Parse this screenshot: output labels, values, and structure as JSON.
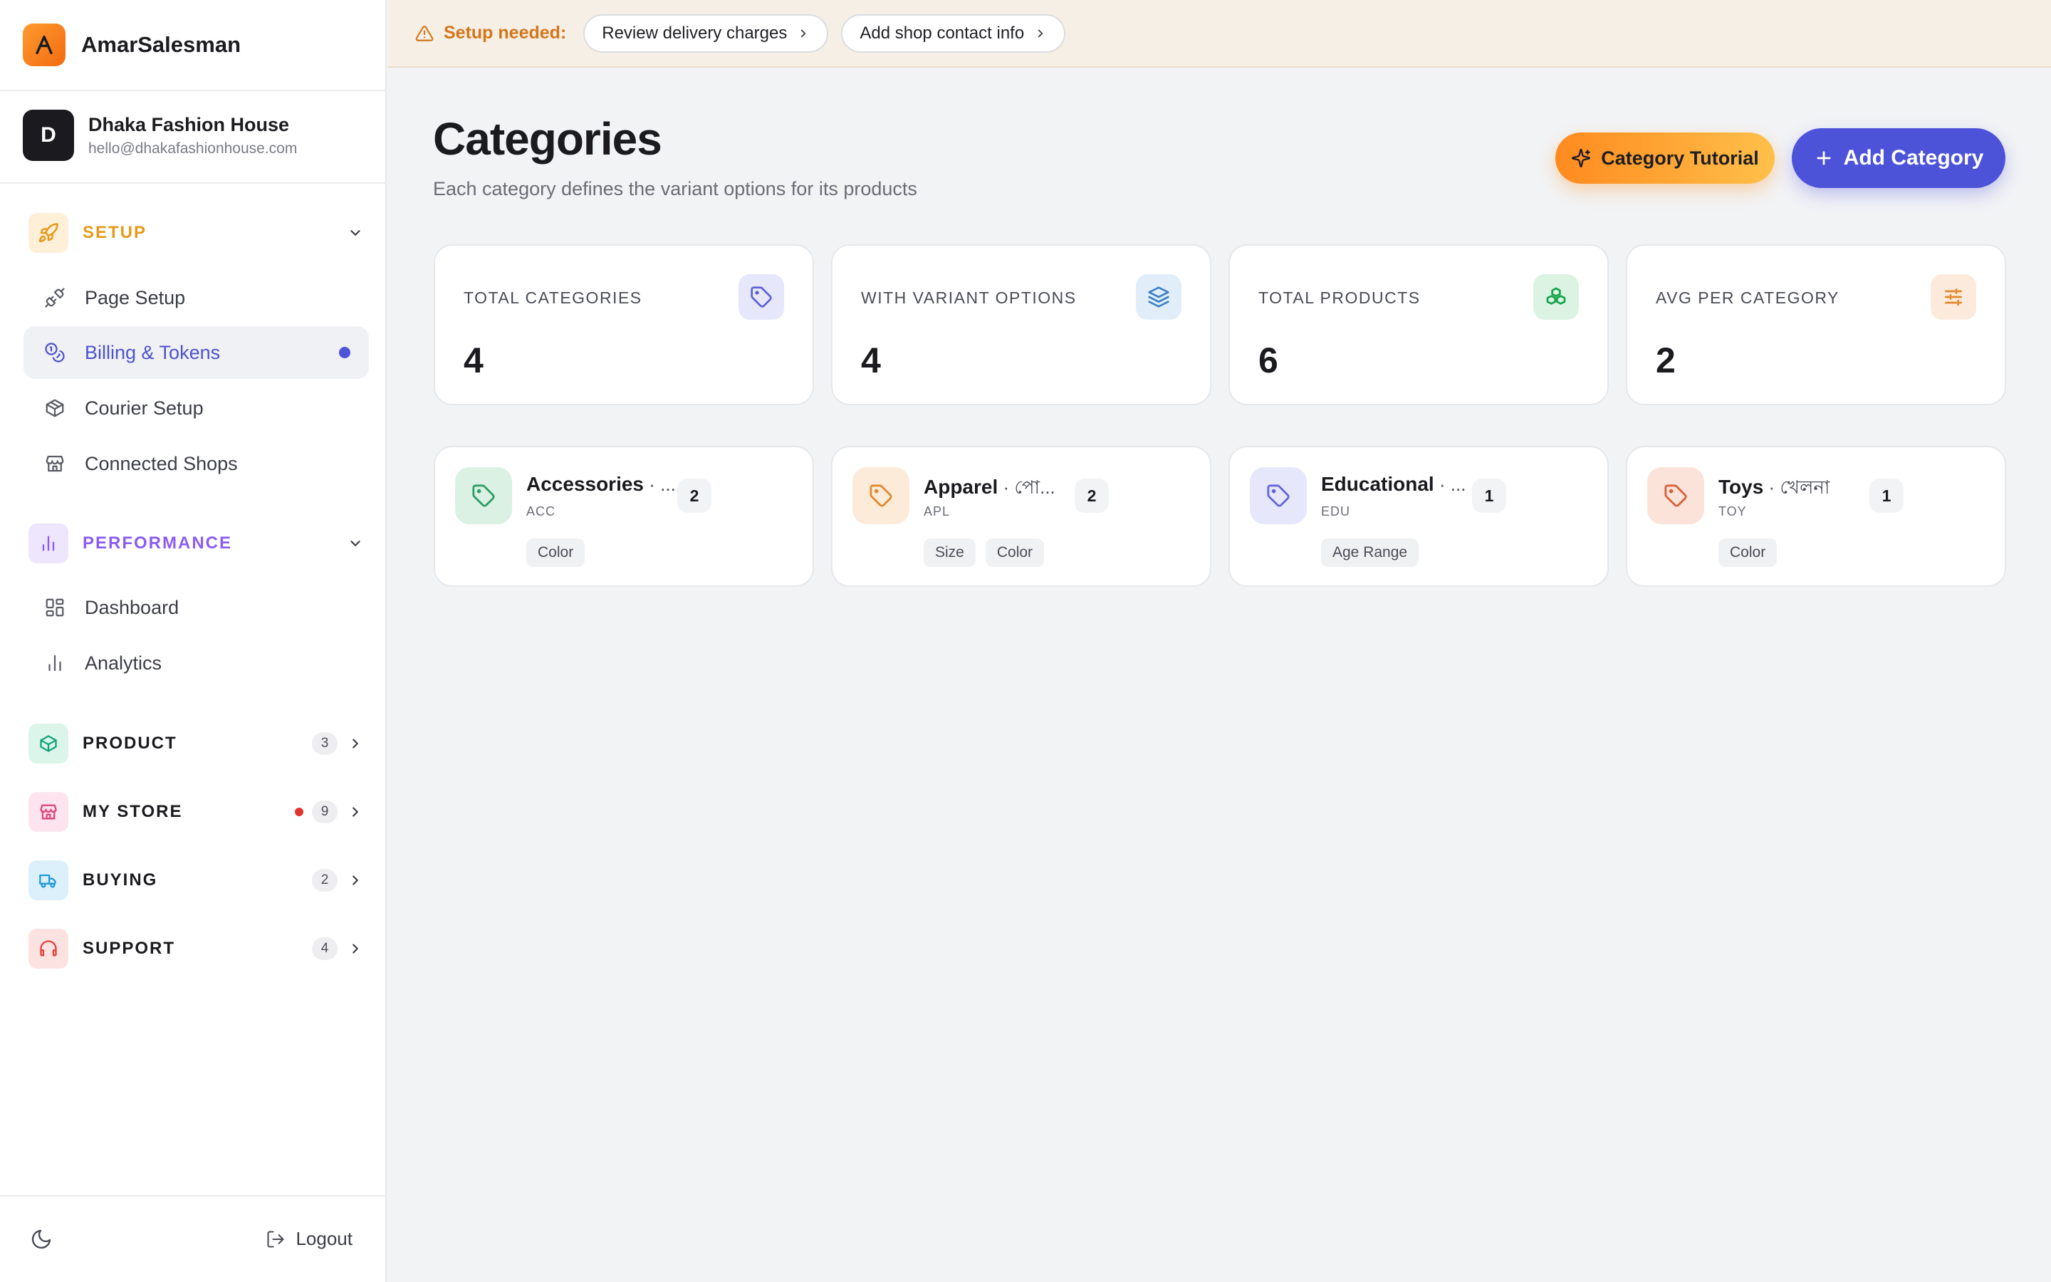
{
  "app": {
    "name": "AmarSalesman",
    "logo_letter": "A"
  },
  "shop": {
    "avatar_letter": "D",
    "name": "Dhaka Fashion House",
    "email": "hello@dhakafashionhouse.com"
  },
  "sidebar": {
    "setup": {
      "label": "SETUP",
      "color": "#e59a1b",
      "items": [
        {
          "label": "Page Setup",
          "icon": "plug-icon"
        },
        {
          "label": "Billing & Tokens",
          "icon": "coins-icon",
          "active": true
        },
        {
          "label": "Courier Setup",
          "icon": "package-icon"
        },
        {
          "label": "Connected Shops",
          "icon": "store-icon"
        }
      ]
    },
    "performance": {
      "label": "PERFORMANCE",
      "color": "#8b5cf6",
      "items": [
        {
          "label": "Dashboard",
          "icon": "dashboard-icon"
        },
        {
          "label": "Analytics",
          "icon": "bar-chart-icon"
        }
      ]
    },
    "product": {
      "label": "PRODUCT",
      "count": "3"
    },
    "my_store": {
      "label": "MY STORE",
      "count": "9",
      "alert": true
    },
    "buying": {
      "label": "BUYING",
      "count": "2"
    },
    "support": {
      "label": "SUPPORT",
      "count": "4"
    },
    "logout_label": "Logout"
  },
  "banner": {
    "label": "Setup needed:",
    "actions": [
      "Review delivery charges",
      "Add shop contact info"
    ]
  },
  "header": {
    "title": "Categories",
    "subtitle": "Each category defines the variant options for its products",
    "tutorial_button": "Category Tutorial",
    "add_button": "Add Category"
  },
  "stats": [
    {
      "label": "TOTAL CATEGORIES",
      "value": "4",
      "icon": "tag-icon",
      "color": "#5b5fd6"
    },
    {
      "label": "WITH VARIANT OPTIONS",
      "value": "4",
      "icon": "layers-icon",
      "color": "#3b82c4"
    },
    {
      "label": "TOTAL PRODUCTS",
      "value": "6",
      "icon": "boxes-icon",
      "color": "#16a34a"
    },
    {
      "label": "AVG PER CATEGORY",
      "value": "2",
      "icon": "sliders-icon",
      "color": "#e0862b"
    }
  ],
  "categories": [
    {
      "name": "Accessories",
      "sub": " · ...",
      "code": "ACC",
      "count": "2",
      "tags": [
        "Color"
      ],
      "color": "#2f9e63"
    },
    {
      "name": "Apparel",
      "sub": " · পো...",
      "code": "APL",
      "count": "2",
      "tags": [
        "Size",
        "Color"
      ],
      "color": "#e08a2e"
    },
    {
      "name": "Educational",
      "sub": " · ...",
      "code": "EDU",
      "count": "1",
      "tags": [
        "Age Range"
      ],
      "color": "#6366d9"
    },
    {
      "name": "Toys",
      "sub": " · খেলনা",
      "code": "TOY",
      "count": "1",
      "tags": [
        "Color"
      ],
      "color": "#d9603b"
    }
  ]
}
